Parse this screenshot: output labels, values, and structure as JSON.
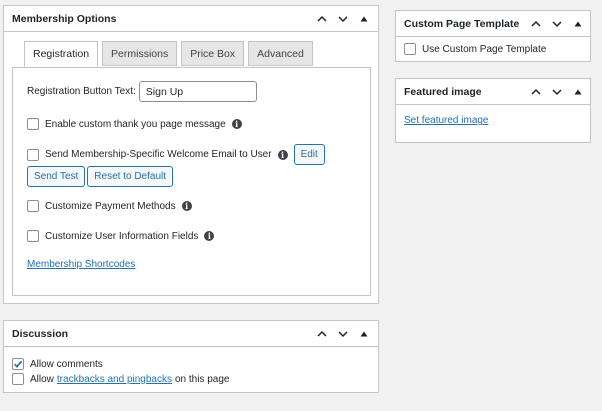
{
  "membership": {
    "title": "Membership Options",
    "tabs": [
      "Registration",
      "Permissions",
      "Price Box",
      "Advanced"
    ],
    "registration_button_label": "Registration Button Text:",
    "registration_button_value": "Sign Up",
    "custom_thank_you": "Enable custom thank you page message",
    "welcome_email": "Send Membership-Specific Welcome Email to User",
    "edit_label": "Edit",
    "send_test_label": "Send Test",
    "reset_label": "Reset to Default",
    "payment_methods": "Customize Payment Methods",
    "user_info_fields": "Customize User Information Fields",
    "shortcodes_link": "Membership Shortcodes"
  },
  "discussion": {
    "title": "Discussion",
    "allow_comments": "Allow comments",
    "allow_prefix": "Allow",
    "trackbacks_link": "trackbacks and pingbacks",
    "allow_suffix": "on this page"
  },
  "custom_template": {
    "title": "Custom Page Template",
    "use_template": "Use Custom Page Template"
  },
  "featured_image": {
    "title": "Featured image",
    "set_link": "Set featured image"
  },
  "info_glyph": "i",
  "icons": [
    "chevron-up-icon",
    "chevron-down-icon",
    "triangle-up-icon",
    "info-icon",
    "checkmark-icon"
  ]
}
